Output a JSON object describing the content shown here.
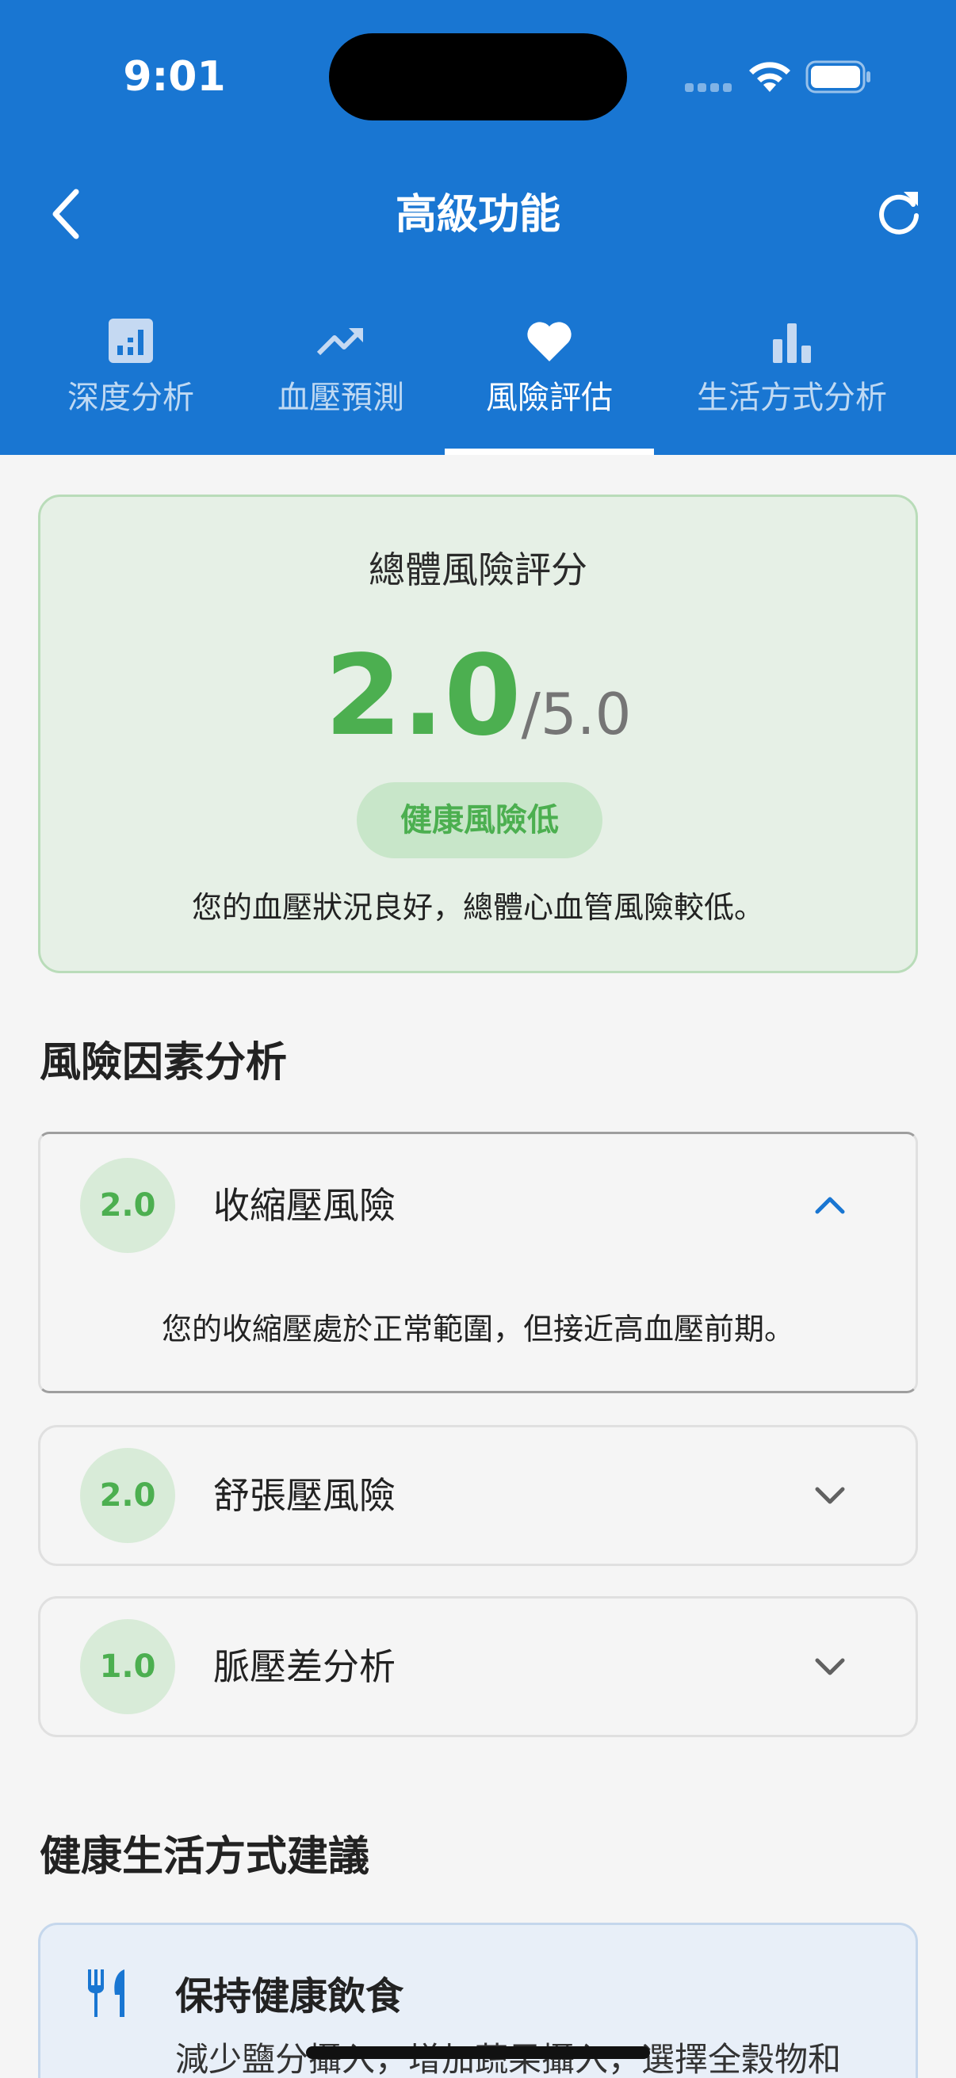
{
  "status_bar": {
    "time": "9:01"
  },
  "header": {
    "title": "高級功能",
    "back_icon": "chevron-left-icon",
    "refresh_icon": "refresh-icon"
  },
  "tabs": [
    {
      "label": "深度分析",
      "icon": "analytics-icon",
      "active": false
    },
    {
      "label": "血壓預測",
      "icon": "trending-up-icon",
      "active": false
    },
    {
      "label": "風險評估",
      "icon": "heart-icon",
      "active": true
    },
    {
      "label": "生活方式分析",
      "icon": "bar-chart-icon",
      "active": false
    }
  ],
  "summary": {
    "title": "總體風險評分",
    "score": "2.0",
    "max": "/5.0",
    "badge": "健康風險低",
    "description": "您的血壓狀況良好，總體心血管風險較低。",
    "accent_color": "#4caf50"
  },
  "factors_section": {
    "title": "風險因素分析",
    "items": [
      {
        "score": "2.0",
        "name": "收縮壓風險",
        "expanded": true,
        "detail": "您的收縮壓處於正常範圍，但接近高血壓前期。"
      },
      {
        "score": "2.0",
        "name": "舒張壓風險",
        "expanded": false
      },
      {
        "score": "1.0",
        "name": "脈壓差分析",
        "expanded": false
      }
    ]
  },
  "lifestyle_section": {
    "title": "健康生活方式建議",
    "tips": [
      {
        "icon": "fork-knife-icon",
        "title": "保持健康飲食",
        "description": "減少鹽分攝入，增加蔬果攝入，選擇全穀物和"
      }
    ]
  },
  "colors": {
    "primary": "#1976d2",
    "success": "#4caf50",
    "background": "#f5f5f5"
  }
}
